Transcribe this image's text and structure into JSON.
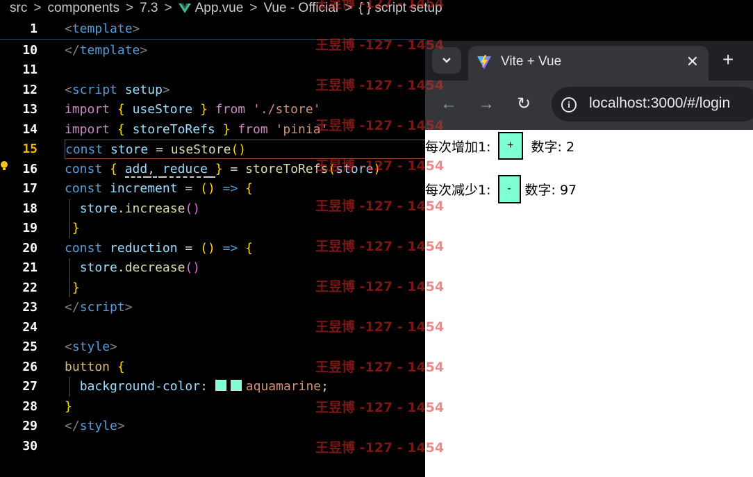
{
  "breadcrumb": [
    "src",
    "components",
    "7.3",
    "App.vue",
    "Vue - Official",
    "{ } script setup"
  ],
  "editor": {
    "numbers": [
      "1",
      "10",
      "11",
      "12",
      "13",
      "14",
      "15",
      "16",
      "17",
      "18",
      "19",
      "20",
      "21",
      "22",
      "23",
      "24",
      "25",
      "26",
      "27",
      "28",
      "29",
      "30"
    ]
  },
  "browser": {
    "tab_title": "Vite + Vue",
    "url": "localhost:3000/#/login",
    "row1": {
      "label": "每次增加1:",
      "button": "+",
      "value": "数字: 2"
    },
    "row2": {
      "label": "每次减少1:",
      "button": "-",
      "value": "数字: 97"
    }
  },
  "watermark": "王昱博 -127 - 1454",
  "colors": {
    "button_bg": "#7fffd4",
    "current_line_border": "#a0433b"
  }
}
